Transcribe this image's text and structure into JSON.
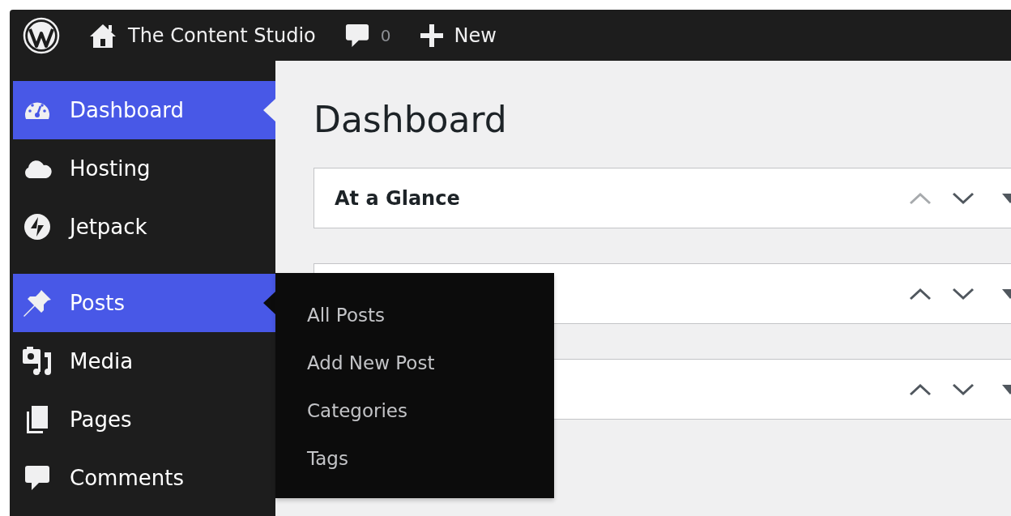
{
  "top_bar": {
    "site_name": "The Content Studio",
    "comment_count": "0",
    "new_label": "New"
  },
  "sidebar": {
    "groups": [
      {
        "items": [
          {
            "label": "Dashboard",
            "selected": true,
            "expanded": false
          },
          {
            "label": "Hosting",
            "selected": false,
            "expanded": false
          },
          {
            "label": "Jetpack",
            "selected": false,
            "expanded": false
          }
        ]
      },
      {
        "items": [
          {
            "label": "Posts",
            "selected": false,
            "expanded": true,
            "submenu": [
              "All Posts",
              "Add New Post",
              "Categories",
              "Tags"
            ]
          },
          {
            "label": "Media",
            "selected": false,
            "expanded": false
          },
          {
            "label": "Pages",
            "selected": false,
            "expanded": false
          },
          {
            "label": "Comments",
            "selected": false,
            "expanded": false
          }
        ]
      }
    ]
  },
  "page": {
    "title": "Dashboard",
    "panels": [
      {
        "title": "At a Glance",
        "move_up_disabled": true
      },
      {
        "move_up_disabled": false
      },
      {
        "move_up_disabled": false
      }
    ]
  }
}
